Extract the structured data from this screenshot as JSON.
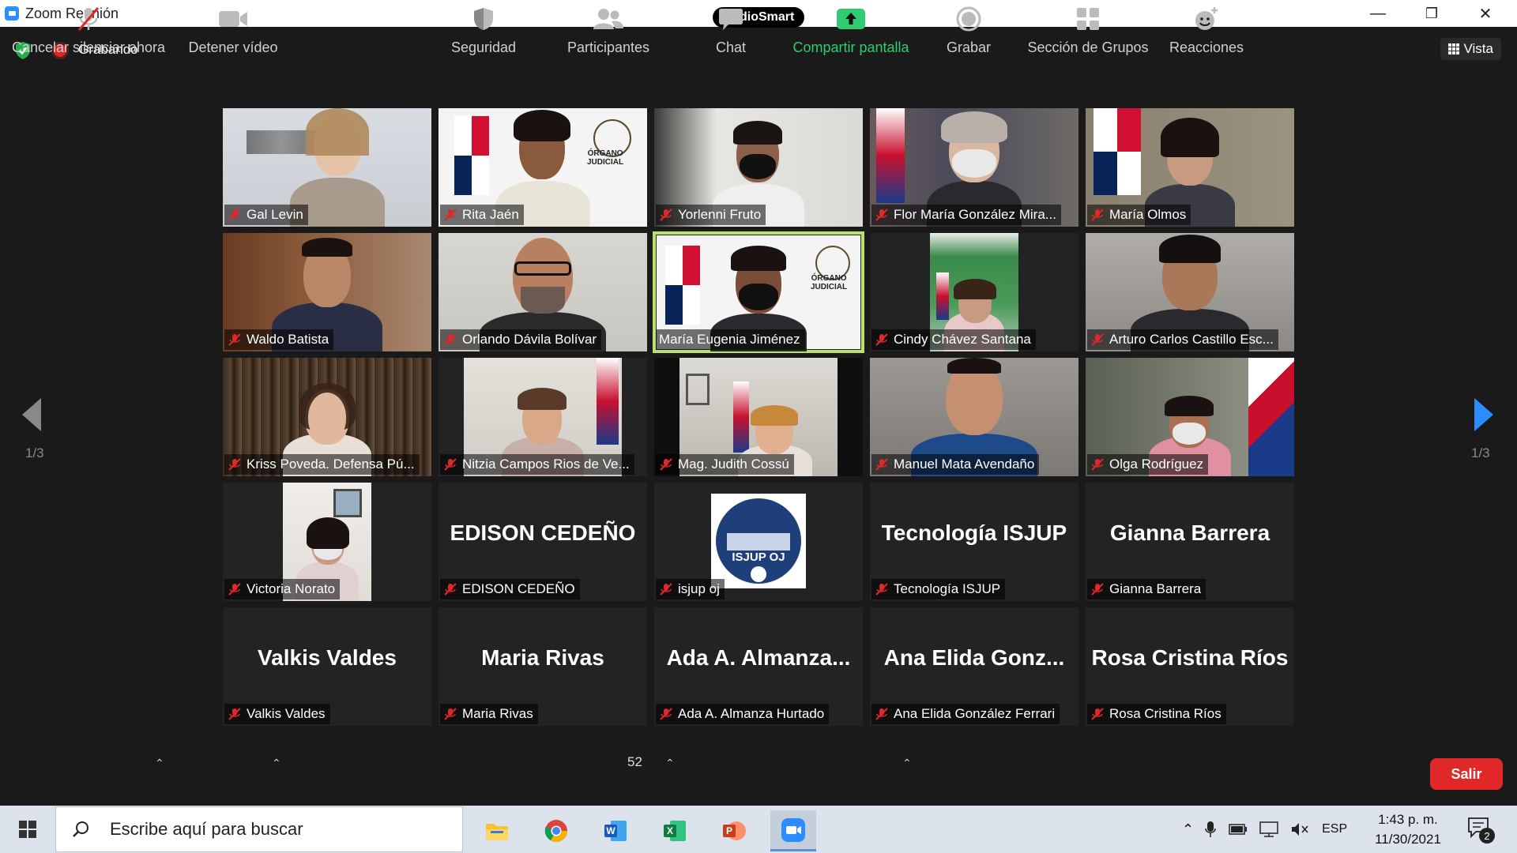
{
  "window": {
    "title": "Zoom Reunión",
    "center_badge": "AudioSmart",
    "minimize": "—",
    "restore": "❐",
    "close": "✕"
  },
  "topbar": {
    "recording_label": "Grabando",
    "view_label": "Vista"
  },
  "pagination": {
    "left": "1/3",
    "right": "1/3"
  },
  "tiles": [
    {
      "name": "Gal Levin"
    },
    {
      "name": "Rita Jaén"
    },
    {
      "name": "Yorlenni Fruto"
    },
    {
      "name": "Flor María González Mira..."
    },
    {
      "name": "María Olmos"
    },
    {
      "name": "Waldo Batista"
    },
    {
      "name": "Orlando Dávila Bolívar"
    },
    {
      "name": "María Eugenia Jiménez"
    },
    {
      "name": "Cindy Chávez Santana"
    },
    {
      "name": "Arturo Carlos Castillo Esc..."
    },
    {
      "name": "Kriss Poveda. Defensa Pú..."
    },
    {
      "name": "Nitzia Campos Rios de Ve..."
    },
    {
      "name": "Mag. Judith Cossú"
    },
    {
      "name": "Manuel Mata Avendaño"
    },
    {
      "name": "Olga Rodríguez"
    },
    {
      "name": "Victoria Norato"
    },
    {
      "name": "EDISON CEDEÑO",
      "display": "EDISON CEDEÑO"
    },
    {
      "name": "isjup oj",
      "logo": "ISJUP OJ"
    },
    {
      "name": "Tecnología ISJUP",
      "display": "Tecnología ISJUP"
    },
    {
      "name": "Gianna Barrera",
      "display": "Gianna Barrera"
    },
    {
      "name": "Valkis Valdes",
      "display": "Valkis Valdes"
    },
    {
      "name": "Maria Rivas",
      "display": "Maria Rivas"
    },
    {
      "name": "Ada A. Almanza Hurtado",
      "display": "Ada A. Almanza..."
    },
    {
      "name": "Ana Elida González Ferrari",
      "display": "Ana Elida Gonz..."
    },
    {
      "name": "Rosa Cristina Ríos",
      "display": "Rosa Cristina Ríos"
    }
  ],
  "logo_text": {
    "organo": "ÓRGANO",
    "judicial": "JUDICIAL"
  },
  "toolbar": {
    "unmute": "Cancelar silenciar ahora",
    "video": "Detener vídeo",
    "security": "Seguridad",
    "participants": "Participantes",
    "participants_count": "52",
    "chat": "Chat",
    "share": "Compartir pantalla",
    "record": "Grabar",
    "breakout": "Sección de Grupos",
    "reactions": "Reacciones",
    "leave": "Salir"
  },
  "taskbar": {
    "search_placeholder": "Escribe aquí para buscar",
    "language": "ESP",
    "time": "1:43 p. m.",
    "date": "11/30/2021",
    "notifications": "2"
  },
  "colors": {
    "accent": "#2d8cff",
    "active_speaker": "#b9e26a",
    "leave": "#e02828",
    "share_green": "#2fcc71"
  }
}
